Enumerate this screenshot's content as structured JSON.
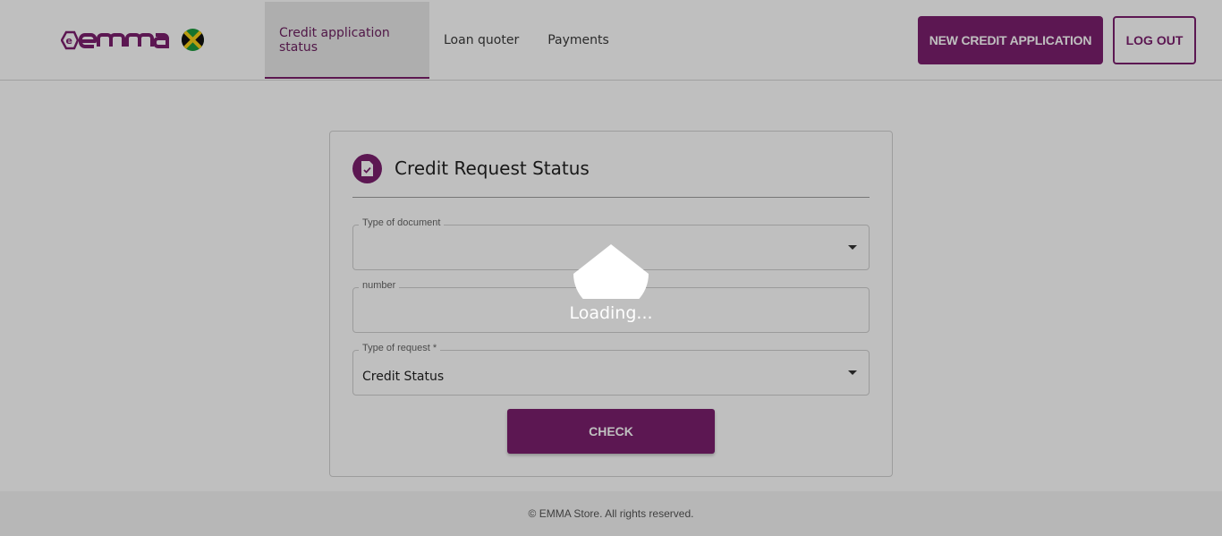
{
  "brand": {
    "logo_icon": "emma-logo",
    "flag_icon": "jamaica-flag-icon",
    "accent": "#7b1f6e"
  },
  "nav": {
    "items": [
      {
        "label": "Credit application status",
        "active": true
      },
      {
        "label": "Loan quoter",
        "active": false
      },
      {
        "label": "Payments",
        "active": false
      }
    ]
  },
  "header_actions": {
    "new_credit": "NEW CREDIT APPLICATION",
    "logout": "LOG OUT"
  },
  "card": {
    "icon": "document-check-icon",
    "title": "Credit Request Status",
    "fields": {
      "document_type": {
        "label": "Type of document",
        "value": ""
      },
      "number": {
        "label": "number",
        "value": ""
      },
      "request_type": {
        "label": "Type of request *",
        "value": "Credit Status"
      }
    },
    "check_button": "CHECK"
  },
  "loading": {
    "text": "Loading..."
  },
  "footer": {
    "text": "© EMMA Store. All rights reserved."
  }
}
